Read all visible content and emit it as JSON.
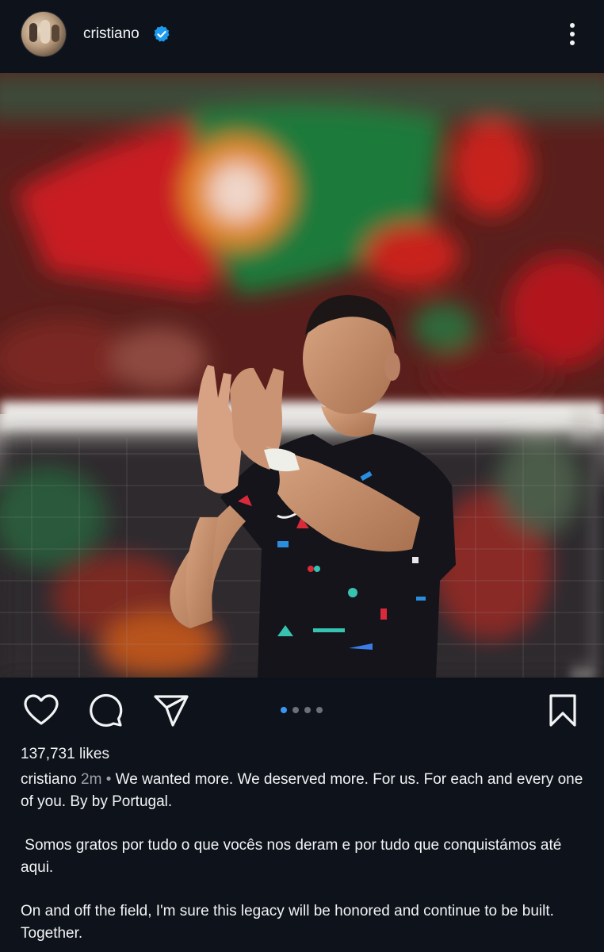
{
  "header": {
    "username": "cristiano",
    "verified": true,
    "avatar_icon": "profile-avatar",
    "more_icon": "more-vertical-icon",
    "verified_color": "#1d9bf0"
  },
  "post": {
    "image_description_icon": "post-photo",
    "carousel": {
      "total": 4,
      "active": 1,
      "active_color": "#3a96f2"
    },
    "actions": {
      "like_icon": "heart-icon",
      "comment_icon": "comment-icon",
      "share_icon": "send-icon",
      "save_icon": "bookmark-icon"
    },
    "likes": "137,731 likes",
    "caption": {
      "username": "cristiano",
      "time": "2m",
      "separator": "•",
      "paragraph1": "We wanted more. We deserved more. For us. For each and every one of you. By by Portugal.",
      "paragraph2": " Somos gratos por tudo o que vocês nos deram e por tudo que conquistámos até aqui.",
      "paragraph3": "On and off the field, I'm sure this legacy will be honored and continue to be built. Together."
    }
  },
  "colors": {
    "background": "#0e131b",
    "text": "#f2f3f5",
    "muted": "#9aa0a8"
  }
}
